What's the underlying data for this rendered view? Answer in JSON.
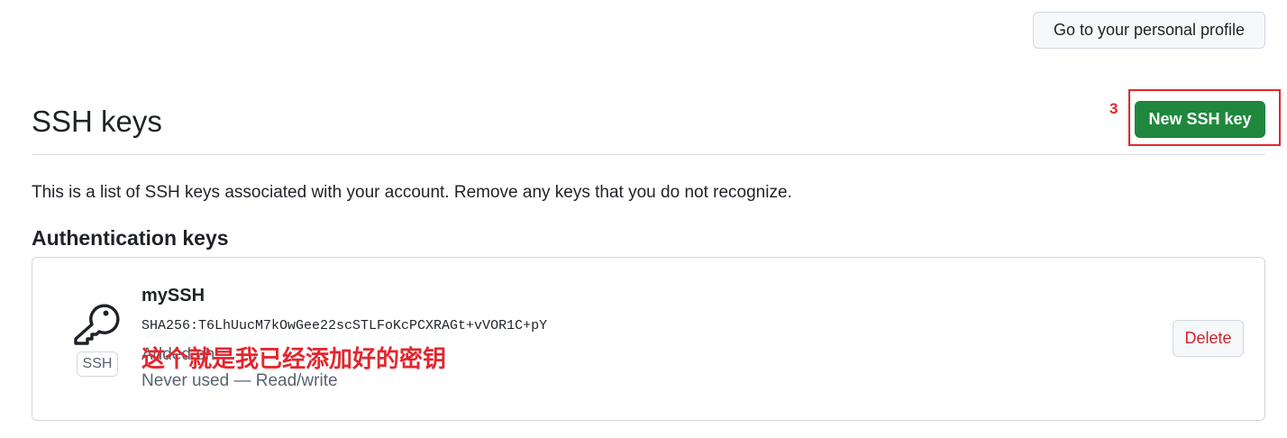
{
  "header": {
    "profile_button_label": "Go to your personal profile"
  },
  "annotations": {
    "step_number": "3",
    "key_note": "这个就是我已经添加好的密钥",
    "color": "#e3262e"
  },
  "page": {
    "title": "SSH keys",
    "new_key_button_label": "New SSH key",
    "description": "This is a list of SSH keys associated with your account. Remove any keys that you do not recognize."
  },
  "auth_keys": {
    "heading": "Authentication keys",
    "items": [
      {
        "title": "mySSH",
        "fingerprint": "SHA256:T6LhUucM7kOwGee22scSTLFoKcPCXRAGt+vVOR1C+pY",
        "added": "Added on",
        "usage": "Never used — Read/write",
        "type_badge": "SSH",
        "icon": "key-icon",
        "delete_label": "Delete"
      }
    ]
  },
  "colors": {
    "primary_button": "#1f883d",
    "danger_text": "#d1242f",
    "muted_text": "#59636e",
    "border": "#d0d7de"
  }
}
